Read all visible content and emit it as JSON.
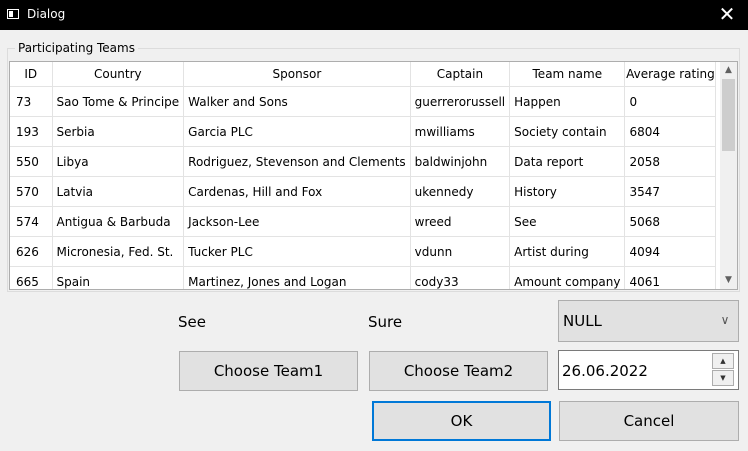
{
  "window": {
    "title": "Dialog"
  },
  "group": {
    "title": "Participating Teams"
  },
  "table": {
    "headers": [
      "ID",
      "Country",
      "Sponsor",
      "Captain",
      "Team name",
      "Average rating"
    ],
    "rows": [
      [
        "73",
        "Sao Tome & Principe",
        "Walker and Sons",
        "guerrerorussell",
        "Happen",
        "0"
      ],
      [
        "193",
        "Serbia",
        "Garcia PLC",
        "mwilliams",
        "Society contain",
        "6804"
      ],
      [
        "550",
        "Libya",
        "Rodriguez, Stevenson and Clements",
        "baldwinjohn",
        "Data report",
        "2058"
      ],
      [
        "570",
        "Latvia",
        "Cardenas, Hill and Fox",
        "ukennedy",
        "History",
        "3547"
      ],
      [
        "574",
        "Antigua & Barbuda",
        "Jackson-Lee",
        "wreed",
        "See",
        "5068"
      ],
      [
        "626",
        "Micronesia, Fed. St.",
        "Tucker PLC",
        "vdunn",
        "Artist during",
        "4094"
      ],
      [
        "665",
        "Spain",
        "Martinez, Jones and Logan",
        "cody33",
        "Amount company",
        "4061"
      ]
    ]
  },
  "labels": {
    "team1": "See",
    "team2": "Sure"
  },
  "combo": {
    "value": "NULL"
  },
  "buttons": {
    "choose1": "Choose Team1",
    "choose2": "Choose Team2",
    "ok": "OK",
    "cancel": "Cancel"
  },
  "date": {
    "value": "26.06.2022"
  },
  "icons": {
    "close": "close-icon",
    "app": "window-icon",
    "combo_arrow": "chevron-down-icon"
  },
  "colors": {
    "focus_border": "#0078d7",
    "titlebar": "#000000"
  }
}
